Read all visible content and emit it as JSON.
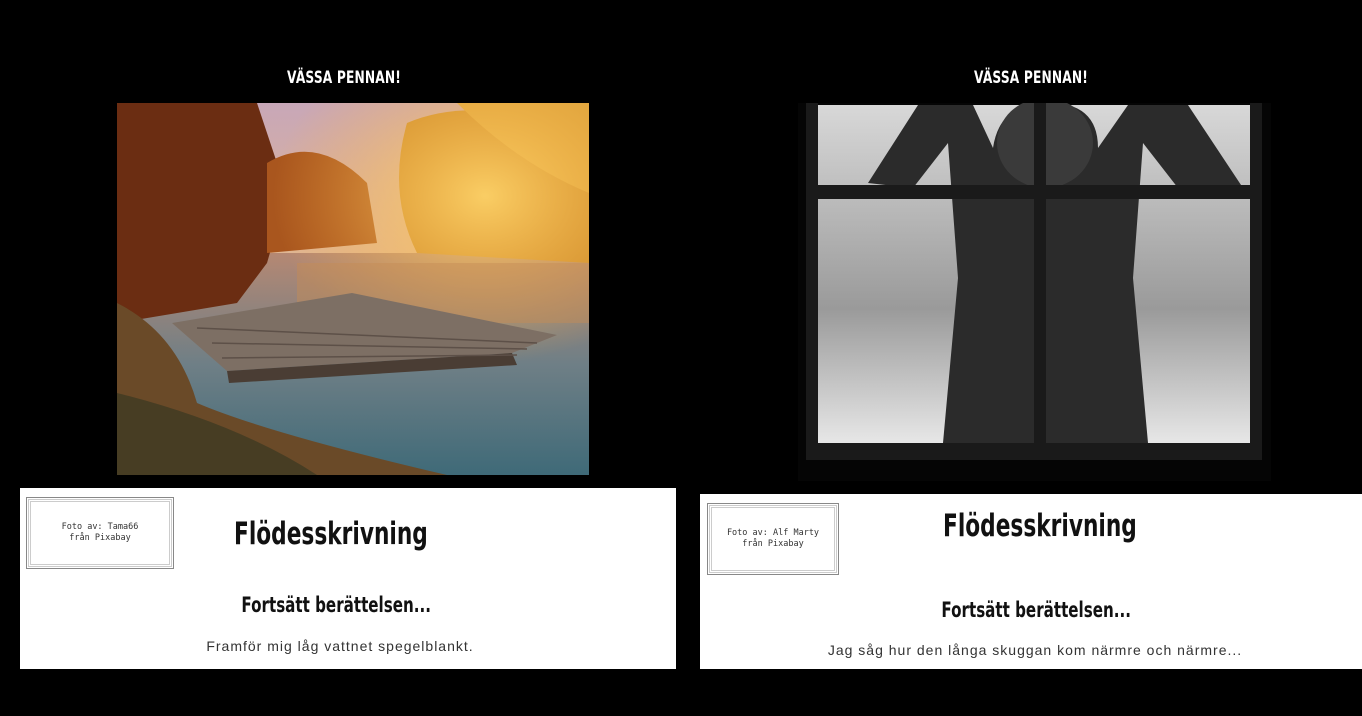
{
  "panels": [
    {
      "header": "VÄSSA PENNAN!",
      "credit_line1": "Foto av: Tama66",
      "credit_line2": "från Pixabay",
      "card_title": "Flödesskrivning",
      "card_subtitle": "Fortsätt berättelsen...",
      "card_text": "Framför mig låg vattnet spegelblankt."
    },
    {
      "header": "VÄSSA PENNAN!",
      "credit_line1": "Foto av: Alf Marty",
      "credit_line2": "från Pixabay",
      "card_title": "Flödesskrivning",
      "card_subtitle": "Fortsätt berättelsen...",
      "card_text": "Jag såg hur den långa skuggan kom närmre och närmre..."
    }
  ]
}
